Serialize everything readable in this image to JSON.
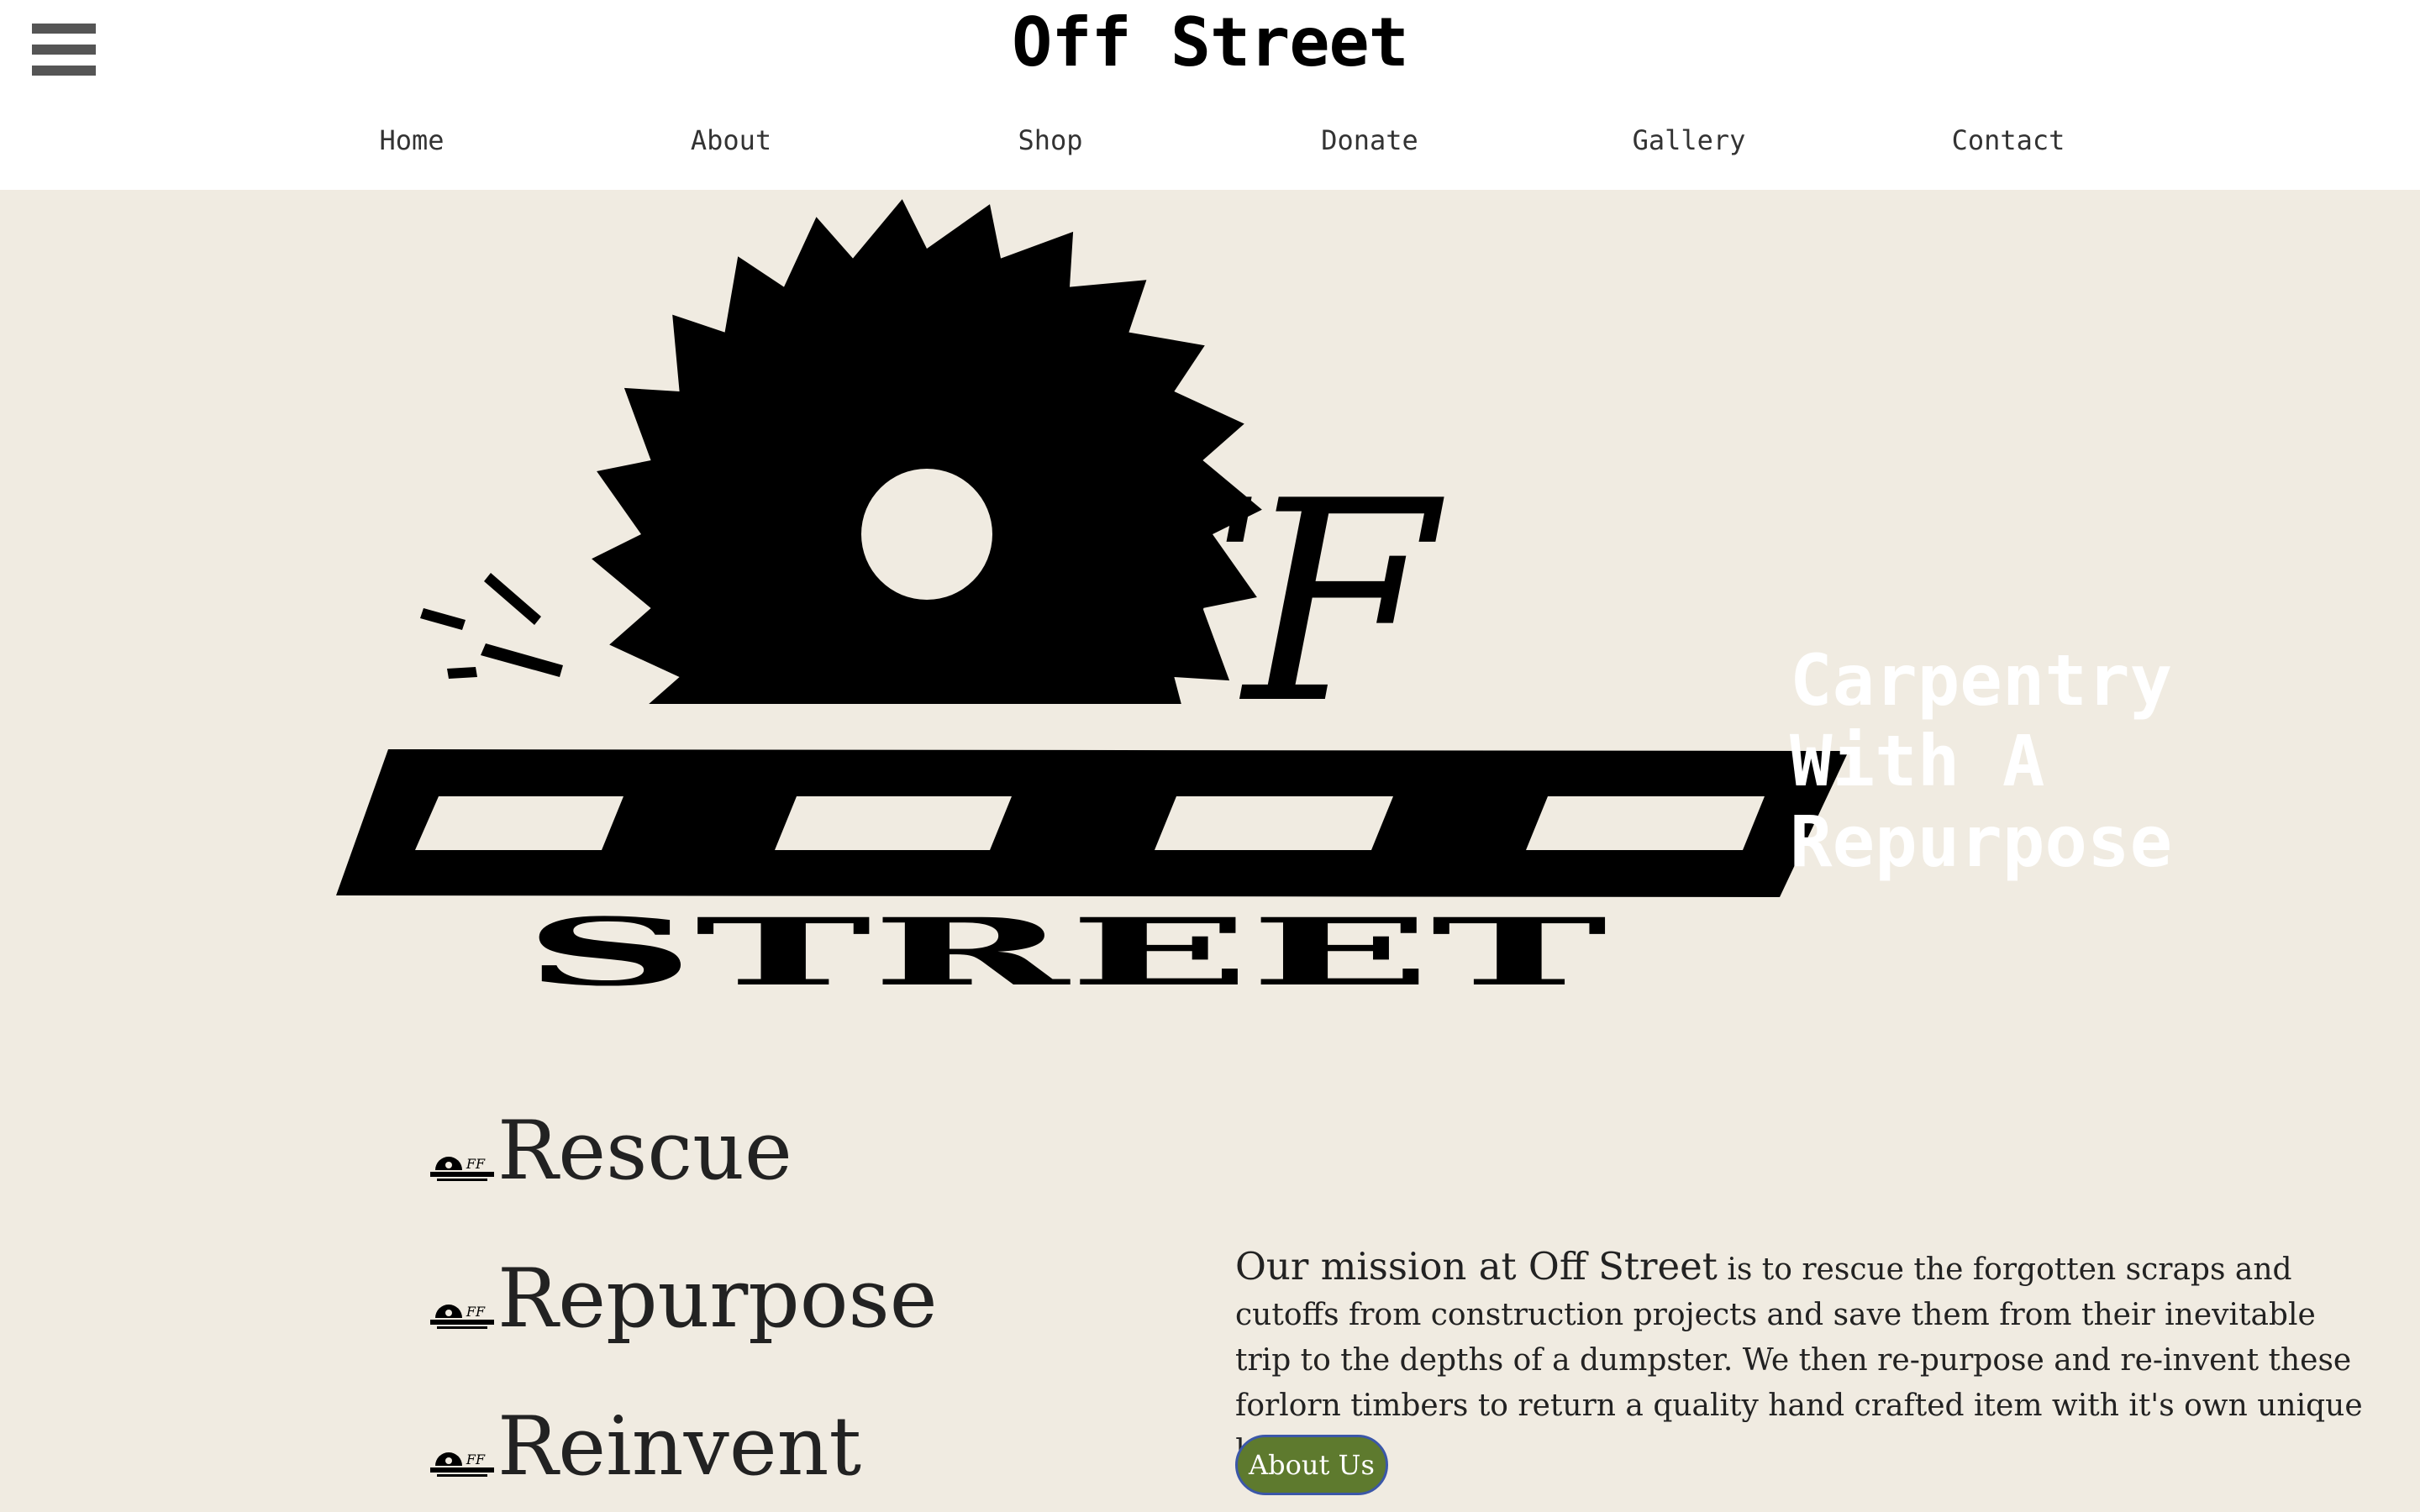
{
  "header": {
    "title": "Off Street",
    "menu_icon": "hamburger-menu-icon"
  },
  "nav": {
    "items": [
      {
        "label": "Home"
      },
      {
        "label": "About"
      },
      {
        "label": "Shop"
      },
      {
        "label": "Donate"
      },
      {
        "label": "Gallery"
      },
      {
        "label": "Contact"
      }
    ]
  },
  "hero": {
    "logo_text": "Off Street",
    "logo_text_ff": "FF",
    "logo_text_street": "STREET",
    "tagline_lines": [
      "Carpentry",
      "With A",
      "Repurpose"
    ]
  },
  "values": {
    "items": [
      {
        "label": "Rescue"
      },
      {
        "label": "Repurpose"
      },
      {
        "label": "Reinvent"
      }
    ]
  },
  "mission": {
    "lead": "Our mission at Off Street",
    "body": " is to rescue the forgotten scraps and cutoffs from construction projects and save them from their inevitable trip to the depths of a dumpster. We then re-purpose and re-invent these forlorn timbers to return a quality hand crafted item with it's own unique history.",
    "button_label": "About Us"
  },
  "colors": {
    "page_background": "#f0ebe1",
    "header_background": "#ffffff",
    "button_background": "#5e7a2e",
    "button_border": "#3b57a8",
    "tagline_text": "#ffffff"
  }
}
